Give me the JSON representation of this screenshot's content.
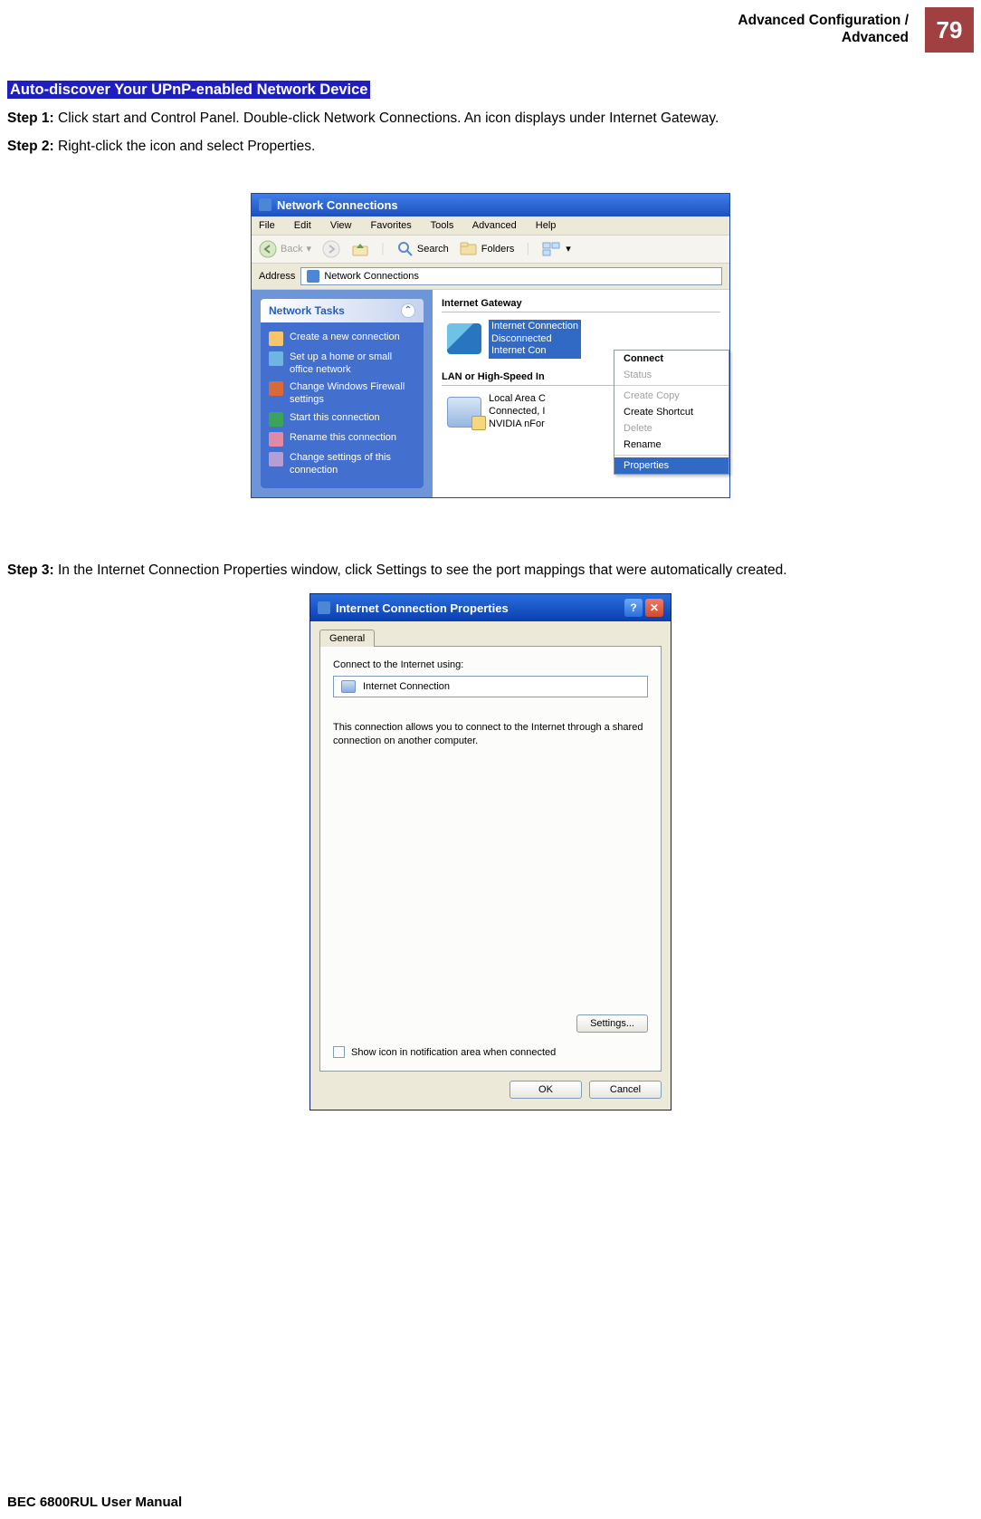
{
  "header": {
    "title_line1": "Advanced Configuration /",
    "title_line2": "Advanced",
    "page_number": "79"
  },
  "section": {
    "heading": "Auto-discover Your UPnP-enabled Network Device"
  },
  "steps": {
    "s1_label": "Step 1:",
    "s1_text": " Click start and Control Panel. Double-click Network Connections. An icon displays under Internet Gateway.",
    "s2_label": "Step 2:",
    "s2_text": " Right-click the icon and select Properties.",
    "s3_label": "Step 3:",
    "s3_text": " In the Internet Connection Properties window, click Settings to see the port mappings that were automatically created."
  },
  "ss1": {
    "title": "Network Connections",
    "menu": [
      "File",
      "Edit",
      "View",
      "Favorites",
      "Tools",
      "Advanced",
      "Help"
    ],
    "toolbar": {
      "back": "Back",
      "search": "Search",
      "folders": "Folders"
    },
    "address_label": "Address",
    "address_value": "Network Connections",
    "side_head": "Network Tasks",
    "side_items": [
      "Create a new connection",
      "Set up a home or small office network",
      "Change Windows Firewall settings",
      "Start this connection",
      "Rename this connection",
      "Change settings of this connection"
    ],
    "grp1": "Internet Gateway",
    "conn1_l1": "Internet Connection",
    "conn1_l2": "Disconnected",
    "conn1_l3": "Internet Con",
    "grp2": "LAN or High-Speed In",
    "conn2_l1": "Local Area C",
    "conn2_l2": "Connected, I",
    "conn2_l3": "NVIDIA nFor",
    "cm": {
      "connect": "Connect",
      "status": "Status",
      "create_copy": "Create Copy",
      "create_shortcut": "Create Shortcut",
      "delete": "Delete",
      "rename": "Rename",
      "properties": "Properties"
    }
  },
  "ss2": {
    "title": "Internet Connection Properties",
    "tab": "General",
    "connect_label": "Connect to the Internet using:",
    "connection_name": "Internet Connection",
    "desc": "This connection allows you to connect to the Internet through a shared connection on another computer.",
    "settings_btn": "Settings...",
    "checkbox_label": "Show icon in notification area when connected",
    "ok": "OK",
    "cancel": "Cancel"
  },
  "footer": "BEC 6800RUL User Manual"
}
